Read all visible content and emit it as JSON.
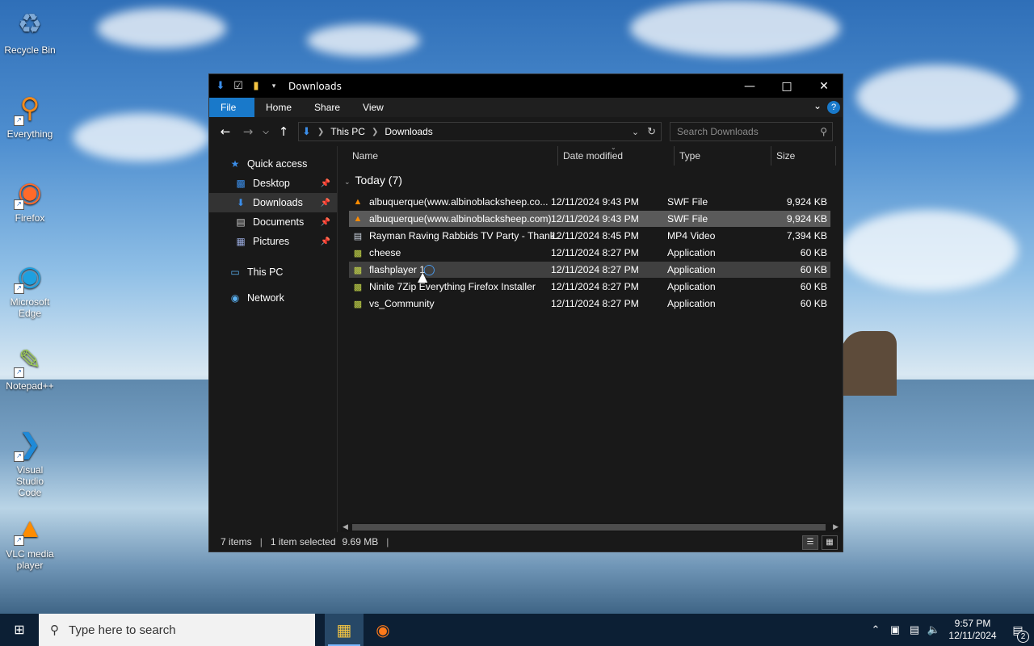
{
  "desktop": {
    "icons": [
      {
        "label": "Recycle Bin",
        "icon": "recycle-bin-icon"
      },
      {
        "label": "Everything",
        "icon": "everything-search-icon"
      },
      {
        "label": "Firefox",
        "icon": "firefox-icon"
      },
      {
        "label": "Microsoft Edge",
        "icon": "edge-icon"
      },
      {
        "label": "Notepad++",
        "icon": "notepadpp-icon"
      },
      {
        "label": "Visual Studio Code",
        "icon": "vscode-icon"
      },
      {
        "label": "VLC media player",
        "icon": "vlc-icon"
      }
    ]
  },
  "window": {
    "title": "Downloads",
    "ribbon": {
      "file": "File",
      "home": "Home",
      "share": "Share",
      "view": "View",
      "help": "?"
    },
    "address": {
      "this_pc": "This PC",
      "downloads": "Downloads"
    },
    "search": {
      "placeholder": "Search Downloads"
    },
    "nav": [
      {
        "label": "Quick access",
        "icon": "star-icon",
        "indent": 0,
        "pinned": false,
        "selected": false
      },
      {
        "label": "Desktop",
        "icon": "desktop-folder-icon",
        "indent": 1,
        "pinned": true,
        "selected": false
      },
      {
        "label": "Downloads",
        "icon": "download-arrow-icon",
        "indent": 1,
        "pinned": true,
        "selected": true
      },
      {
        "label": "Documents",
        "icon": "documents-icon",
        "indent": 1,
        "pinned": true,
        "selected": false
      },
      {
        "label": "Pictures",
        "icon": "pictures-icon",
        "indent": 1,
        "pinned": true,
        "selected": false
      },
      {
        "label": "This PC",
        "icon": "computer-icon",
        "indent": 0,
        "pinned": false,
        "selected": false
      },
      {
        "label": "Network",
        "icon": "network-icon",
        "indent": 0,
        "pinned": false,
        "selected": false
      }
    ],
    "columns": {
      "name": "Name",
      "date": "Date modified",
      "type": "Type",
      "size": "Size"
    },
    "group_label": "Today (7)",
    "files": [
      {
        "name": "albuquerque(www.albinoblacksheep.co...",
        "date": "12/11/2024 9:43 PM",
        "type": "SWF File",
        "size": "9,924 KB",
        "icon": "vlc-file-icon",
        "state": "normal"
      },
      {
        "name": "albuquerque(www.albinoblacksheep.com)",
        "date": "12/11/2024 9:43 PM",
        "type": "SWF File",
        "size": "9,924 KB",
        "icon": "vlc-file-icon",
        "state": "selected"
      },
      {
        "name": "Rayman Raving Rabbids TV Party - Thank...",
        "date": "12/11/2024 8:45 PM",
        "type": "MP4 Video",
        "size": "7,394 KB",
        "icon": "video-file-icon",
        "state": "normal"
      },
      {
        "name": "cheese",
        "date": "12/11/2024 8:27 PM",
        "type": "Application",
        "size": "60 KB",
        "icon": "application-icon",
        "state": "normal"
      },
      {
        "name": "flashplayer 1",
        "date": "12/11/2024 8:27 PM",
        "type": "Application",
        "size": "60 KB",
        "icon": "application-icon",
        "state": "hover"
      },
      {
        "name": "Ninite 7Zip Everything Firefox Installer",
        "date": "12/11/2024 8:27 PM",
        "type": "Application",
        "size": "60 KB",
        "icon": "application-icon",
        "state": "normal"
      },
      {
        "name": "vs_Community",
        "date": "12/11/2024 8:27 PM",
        "type": "Application",
        "size": "60 KB",
        "icon": "application-icon",
        "state": "normal"
      }
    ],
    "status": {
      "count": "7 items",
      "selected": "1 item selected",
      "size": "9.69 MB"
    }
  },
  "taskbar": {
    "search_placeholder": "Type here to search",
    "time": "9:57 PM",
    "date": "12/11/2024",
    "notifications": "2"
  }
}
